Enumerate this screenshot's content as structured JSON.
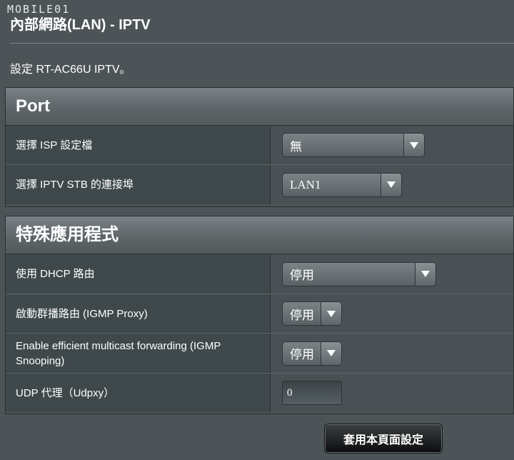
{
  "watermark": "MOBILE01",
  "header": {
    "title": "內部網路(LAN) - IPTV",
    "description": "設定 RT-AC66U IPTV。"
  },
  "port": {
    "title": "Port",
    "isp_profile_label": "選擇 ISP 設定檔",
    "isp_profile_value": "無",
    "stb_port_label": "選擇 IPTV STB 的連接埠",
    "stb_port_value": "LAN1"
  },
  "special": {
    "title": "特殊應用程式",
    "dhcp_route_label": "使用 DHCP 路由",
    "dhcp_route_value": "停用",
    "igmp_proxy_label": "啟動群播路由 (IGMP Proxy)",
    "igmp_proxy_value": "停用",
    "igmp_snooping_label": "Enable efficient multicast forwarding (IGMP Snooping)",
    "igmp_snooping_value": "停用",
    "udpxy_label": "UDP 代理（Udpxy）",
    "udpxy_value": "0"
  },
  "apply_button": "套用本頁面設定",
  "icons": {
    "dropdown": "chevron-down-icon"
  }
}
